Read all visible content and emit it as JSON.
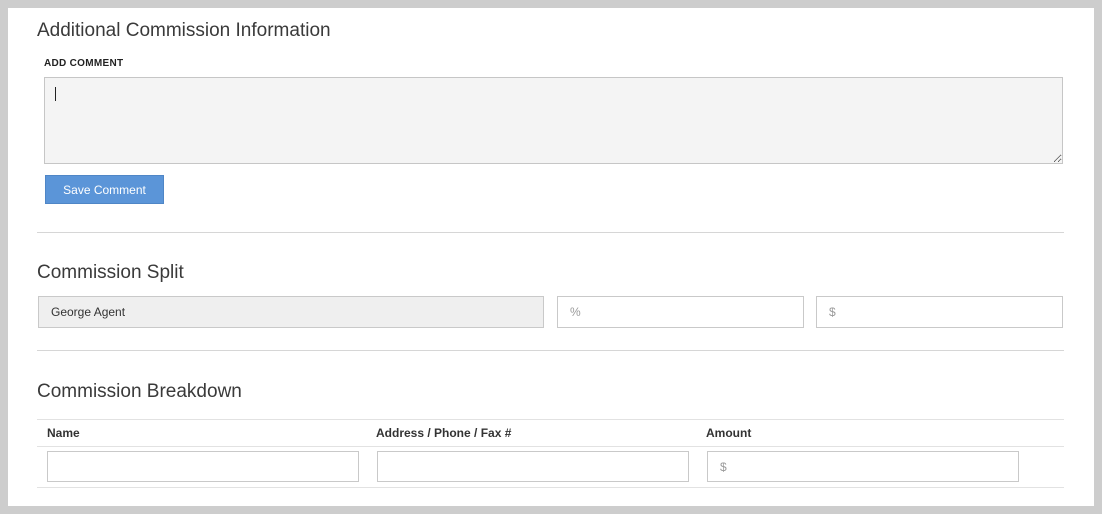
{
  "additional": {
    "title": "Additional Commission Information",
    "comment_label": "ADD COMMENT",
    "comment_value": "",
    "save_label": "Save Comment"
  },
  "split": {
    "title": "Commission Split",
    "agent_name": "George Agent",
    "percent_placeholder": "%",
    "amount_placeholder": "$"
  },
  "breakdown": {
    "title": "Commission Breakdown",
    "columns": [
      "Name",
      "Address / Phone / Fax #",
      "Amount"
    ],
    "row": {
      "name": "",
      "address": "",
      "amount_placeholder": "$"
    }
  },
  "colors": {
    "button": "#5b95d8",
    "background": "#cdcdcd"
  }
}
